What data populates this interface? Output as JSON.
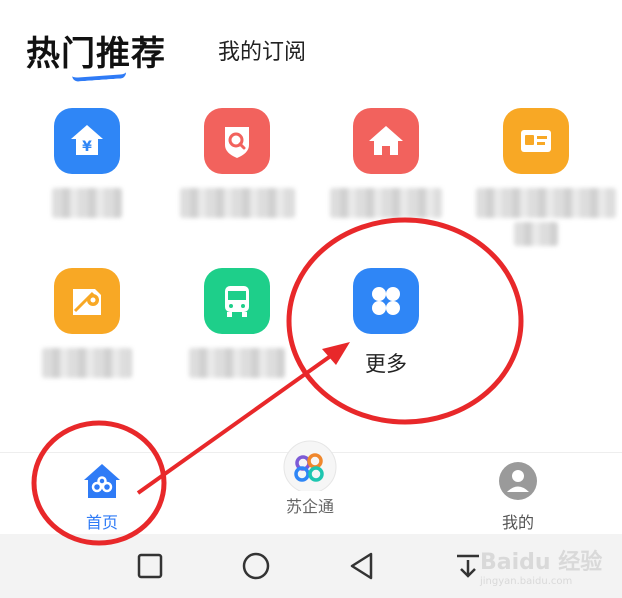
{
  "header": {
    "tab_hot": "热门推荐",
    "tab_subscribe": "我的订阅"
  },
  "apps": [
    {
      "icon": "fund-house-icon",
      "color": "#2f86f6"
    },
    {
      "icon": "search-shield-icon",
      "color": "#f2625d"
    },
    {
      "icon": "home-icon",
      "color": "#f2625d"
    },
    {
      "icon": "id-card-icon",
      "color": "#f8a825"
    },
    {
      "icon": "map-pin-icon",
      "color": "#f8a825"
    },
    {
      "icon": "bus-icon",
      "color": "#1ecf8a"
    },
    {
      "icon": "grid-four-icon",
      "color": "#2f86f6",
      "label": "更多"
    }
  ],
  "bottom_nav": {
    "home": "首页",
    "suqitong": "苏企通",
    "mine": "我的"
  },
  "colors": {
    "accent": "#2f7bf6",
    "annotation": "#e8282a"
  },
  "watermark": "Baidu 经验",
  "watermark_sub": "jingyan.baidu.com"
}
